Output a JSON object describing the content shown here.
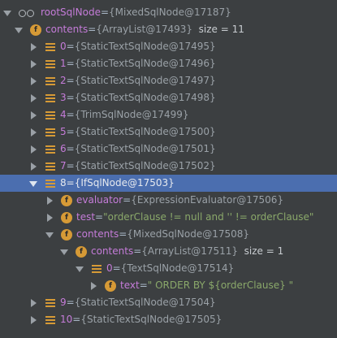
{
  "tree": {
    "root": {
      "name": "rootSqlNode",
      "value": "{MixedSqlNode@17187}"
    },
    "contents": {
      "name": "contents",
      "value": "{ArrayList@17493}",
      "size": "size = 11"
    },
    "items": [
      {
        "name": "0",
        "value": "{StaticTextSqlNode@17495}"
      },
      {
        "name": "1",
        "value": "{StaticTextSqlNode@17496}"
      },
      {
        "name": "2",
        "value": "{StaticTextSqlNode@17497}"
      },
      {
        "name": "3",
        "value": "{StaticTextSqlNode@17498}"
      },
      {
        "name": "4",
        "value": "{TrimSqlNode@17499}"
      },
      {
        "name": "5",
        "value": "{StaticTextSqlNode@17500}"
      },
      {
        "name": "6",
        "value": "{StaticTextSqlNode@17501}"
      },
      {
        "name": "7",
        "value": "{StaticTextSqlNode@17502}"
      },
      {
        "name": "8",
        "value": "{IfSqlNode@17503}"
      },
      {
        "name": "9",
        "value": "{StaticTextSqlNode@17504}"
      },
      {
        "name": "10",
        "value": "{StaticTextSqlNode@17505}"
      }
    ],
    "if_node": {
      "evaluator": {
        "name": "evaluator",
        "value": "{ExpressionEvaluator@17506}"
      },
      "test": {
        "name": "test",
        "value": "\"orderClause != null and '' != orderClause\""
      },
      "contents": {
        "name": "contents",
        "value": "{MixedSqlNode@17508}"
      },
      "inner_contents": {
        "name": "contents",
        "value": "{ArrayList@17511}",
        "size": "size = 1"
      },
      "text_node": {
        "name": "0",
        "value": "{TextSqlNode@17514}"
      },
      "text": {
        "name": "text",
        "value": "\" ORDER BY ${orderClause} \""
      }
    },
    "separator": " = "
  },
  "colors": {
    "background": "#3c3f41",
    "selection": "#4b6eaf",
    "field_icon": "#d69a36",
    "name": "#c57cd9",
    "string": "#8aa86a"
  },
  "icons": {
    "watch": "watch-glasses-icon",
    "field": "field-f-icon",
    "list": "array-element-icon"
  }
}
